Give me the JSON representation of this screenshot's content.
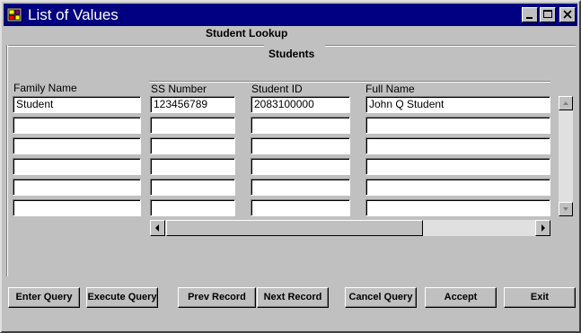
{
  "window": {
    "title": "List of Values"
  },
  "form": {
    "heading": "Student Lookup",
    "block_title": "Students"
  },
  "columns": {
    "family_name": "Family Name",
    "ss_number": "SS Number",
    "student_id": "Student ID",
    "full_name": "Full Name"
  },
  "rows": [
    {
      "family_name": "Student",
      "ss_number": "123456789",
      "student_id": "2083100000",
      "full_name": "John Q Student"
    },
    {
      "family_name": "",
      "ss_number": "",
      "student_id": "",
      "full_name": ""
    },
    {
      "family_name": "",
      "ss_number": "",
      "student_id": "",
      "full_name": ""
    },
    {
      "family_name": "",
      "ss_number": "",
      "student_id": "",
      "full_name": ""
    },
    {
      "family_name": "",
      "ss_number": "",
      "student_id": "",
      "full_name": ""
    },
    {
      "family_name": "",
      "ss_number": "",
      "student_id": "",
      "full_name": ""
    }
  ],
  "buttons": {
    "enter_query": "Enter Query",
    "execute_query": "Execute Query",
    "prev_record": "Prev Record",
    "next_record": "Next Record",
    "cancel_query": "Cancel Query",
    "accept": "Accept",
    "exit": "Exit"
  },
  "icons": {
    "app": "forms-app-icon",
    "minimize": "minimize-icon",
    "maximize": "maximize-icon",
    "close": "close-icon",
    "scroll_up": "arrow-up-icon",
    "scroll_down": "arrow-down-icon",
    "scroll_left": "arrow-left-icon",
    "scroll_right": "arrow-right-icon"
  },
  "colors": {
    "title_bar": "#000080",
    "face": "#c0c0c0",
    "field": "#ffffff"
  }
}
